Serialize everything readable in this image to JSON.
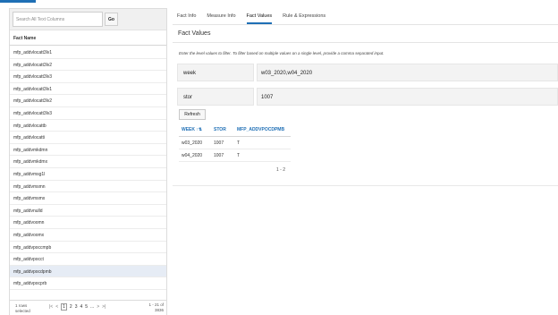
{
  "colors": {
    "accent": "#1f6fb5",
    "selected_row": "#e6ecf5"
  },
  "left_panel": {
    "search_placeholder": "Search All Text Columns",
    "go_label": "Go",
    "column_header": "Fact Name",
    "rows": [
      "mfp_addvlocatt3lv1",
      "mfp_addvlocatt3lv2",
      "mfp_addvlocatt3lv3",
      "mfp_addvlocatt3lv1",
      "mfp_addvlocatt3lv2",
      "mfp_addvlocatt3lv3",
      "mfp_addvlocattb",
      "mfp_addvlocatti",
      "mfp_addvmkdmn",
      "mfp_addvmkdmx",
      "mfp_addvmsg1l",
      "mfp_addvmsmn",
      "mfp_addvmsmx",
      "mfp_addvnulld",
      "mfp_addvoomn",
      "mfp_addvoomx",
      "mfp_addvpoccmpb",
      "mfp_addvpocct",
      "mfp_addvpocdpmb",
      "mfp_addvpocprb"
    ],
    "selected_index": 18,
    "pager": {
      "selected_info": "1 rows selected",
      "first": "|<",
      "prev": "<",
      "pages": [
        "1",
        "2",
        "3",
        "4",
        "5",
        "..."
      ],
      "next": ">",
      "last": ">|",
      "range": "1 - 21 of 3836"
    }
  },
  "tabs": [
    {
      "label": "Fact Info",
      "active": false
    },
    {
      "label": "Measure Info",
      "active": false
    },
    {
      "label": "Fact Values",
      "active": true
    },
    {
      "label": "Rule & Expressions",
      "active": false
    }
  ],
  "section_title": "Fact Values",
  "instructions": "Enter the level values to filter. To filter based on multiple values on a single level, provide a comma separated input.",
  "filters": [
    {
      "label": "week",
      "value": "w03_2020,w04_2020"
    },
    {
      "label": "stor",
      "value": "1007"
    }
  ],
  "refresh_label": "Refresh",
  "result_table": {
    "headers": [
      "WEEK ↑⇅",
      "STOR",
      "MFP_ADDVPOCDPMB"
    ],
    "rows": [
      [
        "w03_2020",
        "1007",
        "T"
      ],
      [
        "w04_2020",
        "1007",
        "T"
      ]
    ],
    "pager": "1 - 2"
  }
}
